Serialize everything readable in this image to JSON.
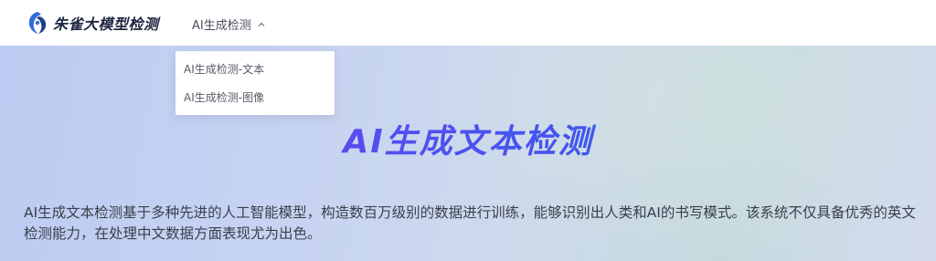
{
  "header": {
    "brand": "朱雀大模型检测",
    "nav_menu_label": "AI生成检测"
  },
  "dropdown": {
    "items": [
      {
        "label": "AI生成检测-文本"
      },
      {
        "label": "AI生成检测-图像"
      }
    ]
  },
  "hero": {
    "title": "AI生成文本检测",
    "description": "AI生成文本检测基于多种先进的人工智能模型，构造数百万级别的数据进行训练，能够识别出人类和AI的书写模式。该系统不仅具备优秀的英文检测能力，在处理中文数据方面表现尤为出色。"
  },
  "colors": {
    "brand_blue": "#2f6bd8",
    "title_gradient_start": "#8a3fe8",
    "title_gradient_end": "#3a63ea"
  },
  "icons": {
    "logo": "zhuque-bird-logo",
    "menu_chevron": "chevron-up-icon"
  }
}
